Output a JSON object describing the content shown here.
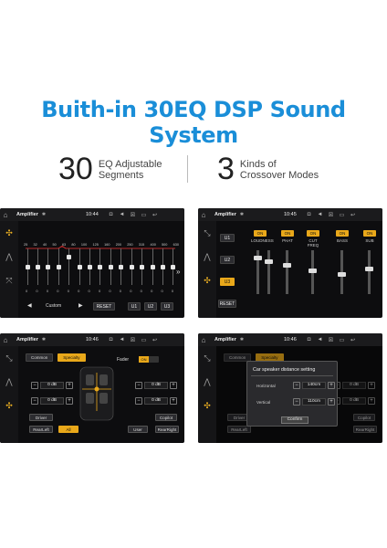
{
  "headline": "Buith-in 30EQ DSP Sound System",
  "stats": [
    {
      "number": "30",
      "line1": "EQ Adjustable",
      "line2": "Segments"
    },
    {
      "number": "3",
      "line1": "Kinds of",
      "line2": "Crossover Modes"
    }
  ],
  "status": {
    "app": "Amplifier",
    "time1": "10:44",
    "time2": "10:45",
    "time3": "10:46"
  },
  "eq": {
    "freqs": [
      "25",
      "32",
      "40",
      "50",
      "63",
      "80",
      "100",
      "125",
      "160",
      "200",
      "250",
      "315",
      "400",
      "500",
      "630"
    ],
    "values": [
      "0",
      "0",
      "0",
      "0",
      "0",
      "0",
      "0",
      "0",
      "0",
      "0",
      "0",
      "0",
      "0",
      "0",
      "0"
    ],
    "levels": [
      0.5,
      0.5,
      0.5,
      0.5,
      0.2,
      0.5,
      0.5,
      0.5,
      0.5,
      0.5,
      0.5,
      0.5,
      0.5,
      0.5,
      0.5
    ],
    "preset": "Custom",
    "reset": "RESET",
    "u1": "U1",
    "u2": "U2",
    "u3": "U3",
    "prev": "◀",
    "next": "▶",
    "more": "»"
  },
  "crossover": {
    "u1": "U1",
    "u2": "U2",
    "u3": "U3",
    "reset": "RESET",
    "columns": [
      {
        "on": "ON",
        "label": "LOUDNESS"
      },
      {
        "on": "ON",
        "label": "PHAT"
      },
      {
        "on": "ON",
        "label": "CUT FREQ"
      },
      {
        "on": "ON",
        "label": "BASS"
      },
      {
        "on": "ON",
        "label": "SUB"
      }
    ]
  },
  "balance": {
    "tab_common": "Common",
    "tab_specialty": "Specialty",
    "fader": "Fader",
    "fader_on": "ON",
    "step_values": [
      "0 dB",
      "0 dB",
      "0 dB",
      "0 dB"
    ],
    "driver": "Driver",
    "copilot": "Copilot",
    "rearleft": "RearLeft",
    "all": "All",
    "user": "User",
    "rearright": "RearRight"
  },
  "dialog": {
    "title": "Car speaker distance setting",
    "horizontal": "Horizontal",
    "horizontal_value": "140cm",
    "vertical": "Vertical",
    "vertical_value": "110cm",
    "confirm": "Confirm"
  },
  "colors": {
    "accent": "#e9a81a",
    "title": "#1a8ed8"
  }
}
